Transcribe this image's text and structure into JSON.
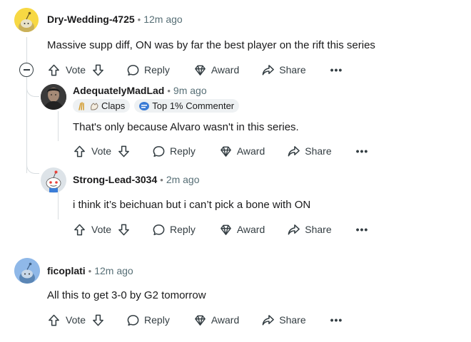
{
  "colors": {
    "text": "#1a1a1b",
    "meta": "#576f76",
    "line": "#d8dde0",
    "badge_bg": "#eef1f3"
  },
  "actions": {
    "vote": "Vote",
    "reply": "Reply",
    "award": "Award",
    "share": "Share",
    "more": "•••"
  },
  "comments": [
    {
      "username": "Dry-Wedding-4725",
      "time": "12m ago",
      "body": "Massive supp diff, ON was by far the best player on the rift this series",
      "avatar": "snoo-avatar-yellow"
    },
    {
      "username": "AdequatelyMadLad",
      "time": "9m ago",
      "badges": [
        {
          "label": "Claps",
          "icon": "claps-icon"
        },
        {
          "label": "Top 1% Commenter",
          "icon": "commenter-icon"
        }
      ],
      "body": "That's only because Alvaro wasn't in this series.",
      "avatar": "user-photo-avatar"
    },
    {
      "username": "Strong-Lead-3034",
      "time": "2m ago",
      "body": "i think it’s beichuan but i can’t pick a bone with ON",
      "avatar": "snoo-avatar-red"
    },
    {
      "username": "ficoplati",
      "time": "12m ago",
      "body": "All this to get 3-0 by G2 tomorrow",
      "avatar": "snoo-avatar-blue"
    }
  ]
}
